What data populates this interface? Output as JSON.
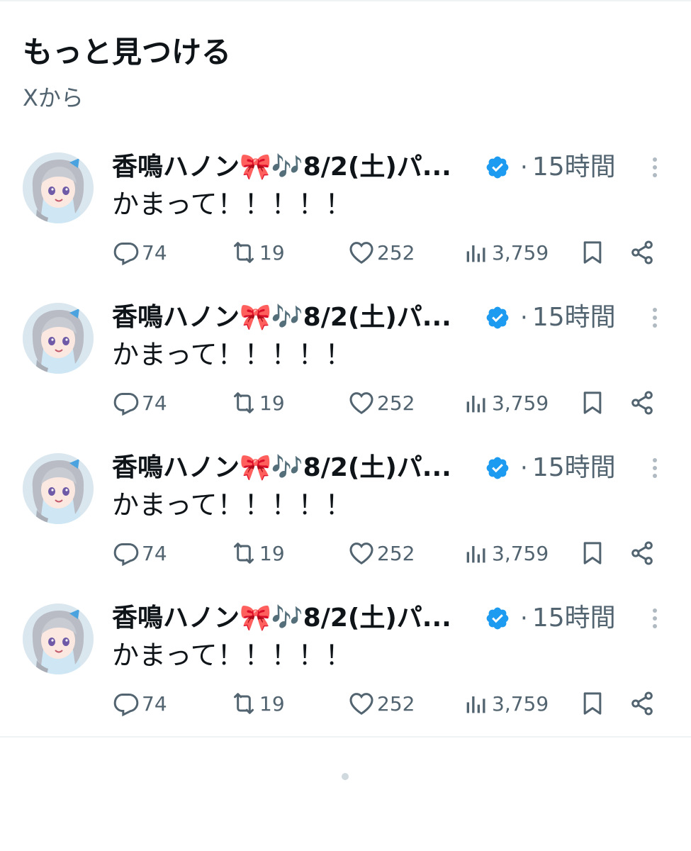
{
  "section": {
    "title": "もっと見つける",
    "subtitle": "Xから"
  },
  "colors": {
    "text_primary": "#0f1419",
    "text_secondary": "#536471",
    "verified_badge": "#1d9bf0",
    "divider": "#eff3f4"
  },
  "icons": {
    "reply": "reply-icon",
    "retweet": "retweet-icon",
    "like": "heart-icon",
    "views": "views-icon",
    "bookmark": "bookmark-icon",
    "share": "share-icon",
    "more": "more-icon",
    "verified": "verified-badge-icon"
  },
  "posts": [
    {
      "display_name": "香鳴ハノン🎀🎶8/2(土)パ...",
      "time": "15時間",
      "separator": "·",
      "text": "かまって！！！！！",
      "replies": "74",
      "retweets": "19",
      "likes": "252",
      "views": "3,759"
    },
    {
      "display_name": "香鳴ハノン🎀🎶8/2(土)パ...",
      "time": "15時間",
      "separator": "·",
      "text": "かまって！！！！！",
      "replies": "74",
      "retweets": "19",
      "likes": "252",
      "views": "3,759"
    },
    {
      "display_name": "香鳴ハノン🎀🎶8/2(土)パ...",
      "time": "15時間",
      "separator": "·",
      "text": "かまって！！！！！",
      "replies": "74",
      "retweets": "19",
      "likes": "252",
      "views": "3,759"
    },
    {
      "display_name": "香鳴ハノン🎀🎶8/2(土)パ...",
      "time": "15時間",
      "separator": "·",
      "text": "かまって！！！！！",
      "replies": "74",
      "retweets": "19",
      "likes": "252",
      "views": "3,759"
    }
  ]
}
